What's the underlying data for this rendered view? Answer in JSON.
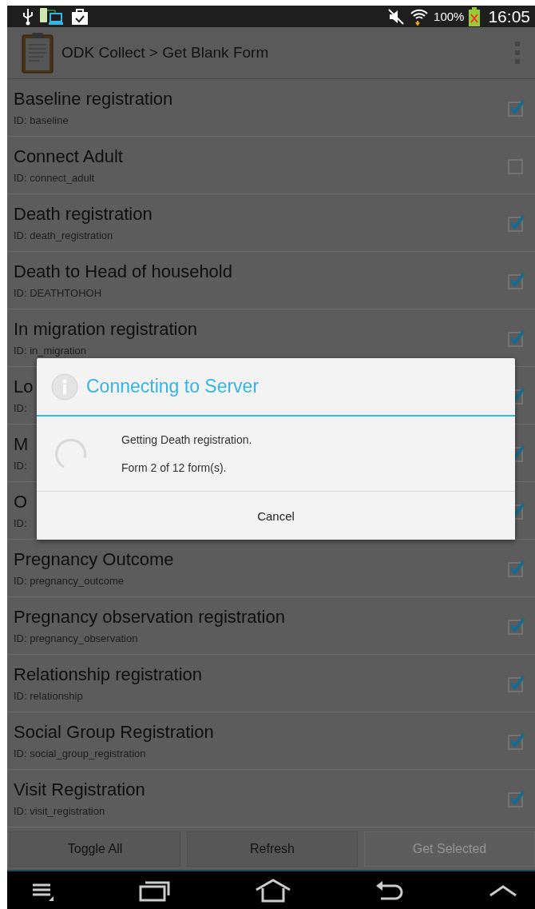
{
  "status_bar": {
    "battery": "100%",
    "time": "16:05"
  },
  "action_bar": {
    "title": "ODK Collect > Get Blank Form"
  },
  "forms": [
    {
      "name": "Baseline registration",
      "id": "ID: baseline",
      "checked": true
    },
    {
      "name": "Connect Adult",
      "id": "ID: connect_adult",
      "checked": false
    },
    {
      "name": "Death registration",
      "id": "ID: death_registration",
      "checked": true
    },
    {
      "name": "Death to Head of household",
      "id": "ID: DEATHTOHOH",
      "checked": true
    },
    {
      "name": "In migration registration",
      "id": "ID: in_migration",
      "checked": true
    },
    {
      "name": "Lo",
      "id": "ID:",
      "checked": true
    },
    {
      "name": "M",
      "id": "ID:",
      "checked": true
    },
    {
      "name": "O",
      "id": "ID:",
      "checked": true
    },
    {
      "name": "Pregnancy Outcome",
      "id": "ID: pregnancy_outcome",
      "checked": true
    },
    {
      "name": "Pregnancy observation  registration",
      "id": "ID: pregnancy_observation",
      "checked": true
    },
    {
      "name": "Relationship registration",
      "id": "ID: relationship",
      "checked": true
    },
    {
      "name": "Social Group Registration",
      "id": "ID: social_group_registration",
      "checked": true
    },
    {
      "name": "Visit Registration",
      "id": "ID: visit_registration",
      "checked": true
    }
  ],
  "buttons": [
    {
      "label": "Toggle All",
      "disabled": false
    },
    {
      "label": "Refresh",
      "disabled": false
    },
    {
      "label": "Get Selected",
      "disabled": true
    }
  ],
  "dialog": {
    "title": "Connecting to Server",
    "messages": [
      "Getting Death registration.",
      "Form 2 of 12 form(s)."
    ],
    "button": "Cancel"
  }
}
